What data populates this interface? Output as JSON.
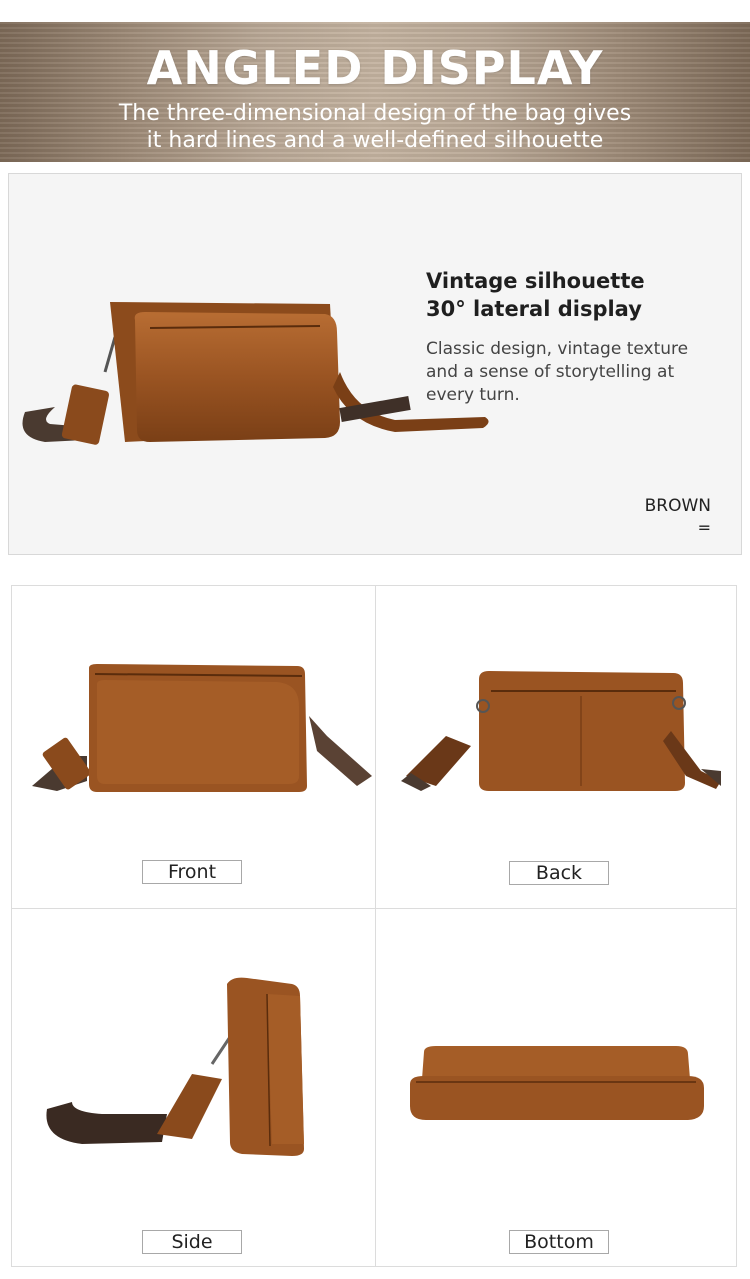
{
  "banner": {
    "title": "ANGLED DISPLAY",
    "subtitle_line1": "The three-dimensional design of the bag gives",
    "subtitle_line2": "it hard lines and a well-defined silhouette"
  },
  "hero": {
    "heading_line1": "Vintage silhouette",
    "heading_line2": "30° lateral display",
    "desc_line1": "Classic design, vintage texture",
    "desc_line2": "and a sense of storytelling at",
    "desc_line3": "every turn.",
    "color_name": "BROWN",
    "color_mark": "="
  },
  "views": [
    {
      "label": "Front"
    },
    {
      "label": "Back"
    },
    {
      "label": "Side"
    },
    {
      "label": "Bottom"
    }
  ],
  "colors": {
    "leather": "#9a5422",
    "leather_light": "#b86d33",
    "leather_dark": "#6e3812",
    "strap": "#4a3a30"
  }
}
